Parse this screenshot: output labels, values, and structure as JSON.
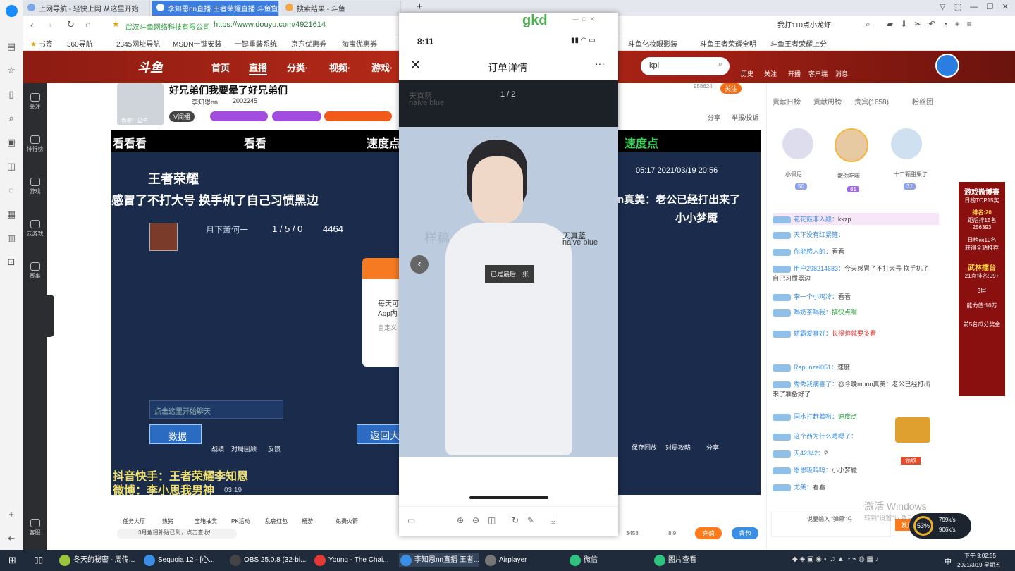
{
  "browser": {
    "tabs": [
      {
        "label": "上网导航 - 轻快上网 从这里开始"
      },
      {
        "label": "李知恩nn直播 王者荣耀直播 斗鱼直"
      },
      {
        "label": "搜索结果 - 斗鱼"
      }
    ],
    "site_name": "武汉斗鱼网络科技有限公司",
    "url": "https://www.douyu.com/4921614",
    "search_text": "我打110点小龙虾",
    "bookmarks": [
      "书签",
      "360导航",
      "2345网址导航",
      "MSDN一键安装",
      "一键重装系统",
      "京东优惠券",
      "淘宝优惠券",
      "斗鱼化妆眼影装",
      "斗鱼王者荣耀全明",
      "斗鱼王者荣耀上分"
    ]
  },
  "sidebar_labels": [
    "关注",
    "排行榜",
    "游戏",
    "云游戏",
    "赛事",
    "客服"
  ],
  "douyu": {
    "logo": "斗鱼",
    "nav": [
      "首页",
      "直播",
      "分类·",
      "视频·",
      "游戏·"
    ],
    "search_value": "kpl",
    "top_icons": [
      "历史",
      "关注",
      "开播",
      "客户端",
      "消息"
    ],
    "streamer_title": "好兄弟们我要晕了好兄弟们",
    "streamer_name": "李知恩nn",
    "follower_count": "2002245",
    "badge_text": "V闻播",
    "room_label": "鱼吧 | 公告",
    "share": "分享",
    "report": "举报/投诉",
    "follow_btn": "关注",
    "room_count": "958624",
    "video": {
      "banner_left": "看看看",
      "banner_mid": "看看",
      "banner_right": "速度点",
      "game_logo": "王者荣耀",
      "caption1": "感冒了不打大号 换手机了自己习惯黑边",
      "player": "月下萧何一",
      "kda": "1 / 5 / 0",
      "score": "4464",
      "right_caption": "n真美：老公已经打出来了",
      "right_name": "小小梦魇",
      "time": "05:17  2021/03/19 20:56",
      "chat_placeholder": "点击这里开始聊天",
      "data_btn": "数据",
      "btn_battle": "战绩",
      "btn_replay": "对局回顾",
      "btn_bug": "反馈",
      "return_btn": "返回大",
      "save_replay": "保存回放",
      "strategy": "对局攻略",
      "share2": "分享",
      "overlay1": "抖音快手：王者荣耀李知恩",
      "overlay2": "微博：李小思我男神",
      "date": "03.19",
      "popup_text": "每天可",
      "popup_text2": "App内",
      "popup_text3": "自定义"
    },
    "chat_tabs": [
      "贡献日榜",
      "贡献周榜",
      "贵宾(1658)",
      "粉丝团"
    ],
    "top3": [
      {
        "name": "小佩尼",
        "lv": "50"
      },
      {
        "name": "嫩你吃嘛",
        "lv": "81"
      },
      {
        "name": "十二颗甜果了",
        "lv": "31"
      }
    ],
    "chat": [
      {
        "user": "花花鼓非入殿：",
        "msg": "kkzp"
      },
      {
        "user": "",
        "msg": "天下没有红紧箍："
      },
      {
        "user": "你能感人的：",
        "msg": "看看"
      },
      {
        "user": "用户298214683：",
        "msg": "今天感冒了不打大号 换手机了自己习惯黑边"
      },
      {
        "user": "李一个小鸡冷：",
        "msg": "看看"
      },
      {
        "user": "喝奶茶喝我：",
        "msg": "搞快点啊"
      },
      {
        "user": "娇霸爱真好：",
        "msg": "长得帅就要多看"
      },
      {
        "user": "Rapunzel051：",
        "msg": "速度"
      },
      {
        "user": "秀秀我病喜了：",
        "msg": "@今晚moon真美：老公已经打出来了准备好了"
      },
      {
        "user": "同水打赶着啦：",
        "msg": "速度点"
      },
      {
        "user": "这个西为什么嗯嗯了：",
        "msg": ""
      },
      {
        "user": "天42342：",
        "msg": "?"
      },
      {
        "user": "恩恩吸鸣吗：",
        "msg": "小小梦魇"
      },
      {
        "user": "尤美：",
        "msg": "看看"
      }
    ],
    "bottom_tasks": [
      "任务大厅",
      "热猪",
      "宝箱抽奖",
      "PK活动",
      "乱鹿红包",
      "畅游",
      "免费火箭"
    ],
    "notice": "3月鱼翅补贴已到，点击查收!",
    "fish_count": "3458",
    "fish_ball": "8.9",
    "recharge": "充值",
    "backpack": "背包",
    "rank_ad": {
      "title": "游戏微博赛",
      "sub": "日榜TOP15奖",
      "rank": "排名:20",
      "gap": "距后排15名",
      "gap_val": "256393",
      "daily": "日榜前10名",
      "gift": "获得全站推荐",
      "ring": "武林擂台",
      "ring_sub": "21点排名:99+",
      "level": "3层",
      "power": "能力值:10万",
      "tail": "前5名瓜分奖金"
    },
    "chat_input": "说要输入 \"弹幕\"吗",
    "chat_send": "发送",
    "pkg_hint": "领取"
  },
  "phone": {
    "title_app": "gkd",
    "time": "8:11",
    "page_title": "订单详情",
    "counter": "1 / 2",
    "toast": "已是最后一张",
    "watermark": "样稿",
    "brand": "天真蓝",
    "brand2": "naive blue"
  },
  "windows": {
    "watermark": "激活 Windows",
    "watermark_sub": "转到\"设置\"以激活 Windows。",
    "cpu": "53%",
    "net_up": "799k/s",
    "net_down": "906k/s",
    "time": "下午 9:02:55",
    "date": "2021/3/19 星期五",
    "tasks": [
      "冬天的秘密 - 周传...",
      "Sequoia 12 - [心...",
      "OBS 25.0.8 (32-bi...",
      "Young - The Chai...",
      "李知恩nn直播 王者...",
      "Airplayer",
      "微信",
      "图片查看"
    ],
    "lang": "中"
  }
}
